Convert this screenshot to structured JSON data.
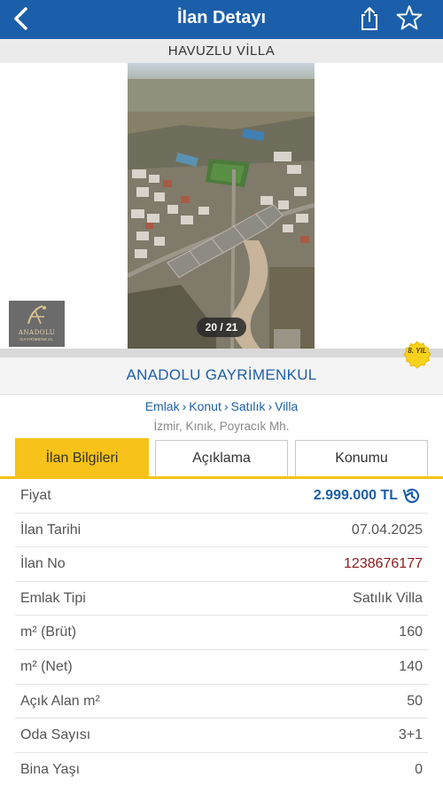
{
  "header": {
    "title": "İlan Detayı"
  },
  "listing": {
    "headline": "HAVUZLU VİLLA"
  },
  "gallery": {
    "counter": "20 / 21"
  },
  "agency": {
    "logo_text": "ANADOLU",
    "logo_subtext": "GAYRİMENKUL",
    "name": "ANADOLU GAYRİMENKUL",
    "badge_text": "8. YIL"
  },
  "breadcrumb": {
    "items": [
      "Emlak",
      "Konut",
      "Satılık",
      "Villa"
    ],
    "separator": "›"
  },
  "location": "İzmir, Kınık, Poyracık Mh.",
  "tabs": [
    "İlan Bilgileri",
    "Açıklama",
    "Konumu"
  ],
  "details": [
    {
      "label": "Fiyat",
      "value": "2.999.000 TL"
    },
    {
      "label": "İlan Tarihi",
      "value": "07.04.2025"
    },
    {
      "label": "İlan No",
      "value": "1238676177"
    },
    {
      "label": "Emlak Tipi",
      "value": "Satılık Villa"
    },
    {
      "label": "m² (Brüt)",
      "value": "160"
    },
    {
      "label": "m² (Net)",
      "value": "140"
    },
    {
      "label": "Açık Alan m²",
      "value": "50"
    },
    {
      "label": "Oda Sayısı",
      "value": "3+1"
    },
    {
      "label": "Bina Yaşı",
      "value": "0"
    }
  ],
  "colors": {
    "header_bg": "#1b5faa",
    "accent_yellow": "#f7c219",
    "link_blue": "#1b5faa",
    "listing_no": "#8b1a1a"
  },
  "icons": {
    "back": "chevron-left-icon",
    "share": "share-icon",
    "favorite": "star-outline-icon",
    "price_history": "history-icon"
  }
}
